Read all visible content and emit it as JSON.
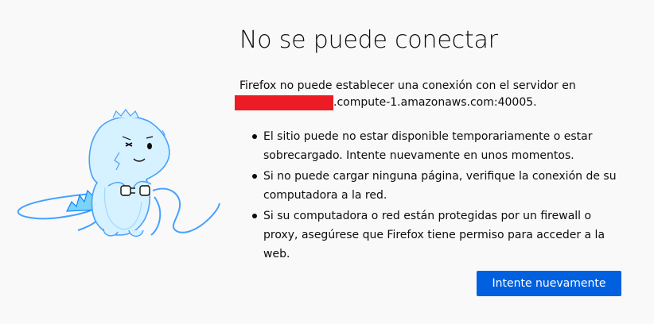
{
  "error": {
    "title": "No se puede conectar",
    "intro_line1": "Firefox no puede establecer una conexión con el servidor en",
    "host_suffix": ".compute-1.amazonaws.com:40005.",
    "items": [
      "El sitio puede no estar disponible temporariamente o estar sobrecargado. Intente nuevamente en unos momentos.",
      "Si no puede cargar ninguna página, verifique la conexión de su computadora a la red.",
      "Si su computadora o red están protegidas por un firewall o proxy, asegúrese que Firefox tiene permiso para acceder a la web."
    ],
    "retry_label": "Intente nuevamente",
    "redaction_color": "#ed1c24",
    "accent_color": "#0060df",
    "illustration_icon": "dino-unplugged-icon"
  }
}
